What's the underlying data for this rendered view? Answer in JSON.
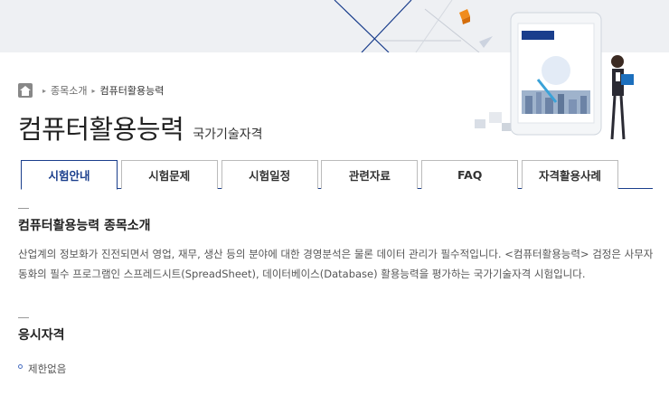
{
  "breadcrumb": {
    "items": [
      "종목소개",
      "컴퓨터활용능력"
    ]
  },
  "title": {
    "main": "컴퓨터활용능력",
    "sub": "국가기술자격"
  },
  "tabs": [
    {
      "label": "시험안내",
      "active": true
    },
    {
      "label": "시험문제",
      "active": false
    },
    {
      "label": "시험일정",
      "active": false
    },
    {
      "label": "관련자료",
      "active": false
    },
    {
      "label": "FAQ",
      "active": false
    },
    {
      "label": "자격활용사례",
      "active": false
    }
  ],
  "intro": {
    "heading": "컴퓨터활용능력 종목소개",
    "body": "산업계의 정보화가 진전되면서 영업, 재무, 생산 등의 분야에 대한 경영분석은 물론 데이터 관리가 필수적입니다. <컴퓨터활용능력> 검정은 사무자동화의 필수 프로그램인 스프레드시트(SpreadSheet), 데이터베이스(Database) 활용능력을 평가하는 국가기술자격 시험입니다."
  },
  "eligibility": {
    "heading": "응시자격",
    "item": "제한없음"
  },
  "colors": {
    "accent": "#1a3e8c",
    "band": "#eef0f3",
    "bullet": "#4a6fc2"
  },
  "icons": [
    "home-icon",
    "tablet-illustration",
    "person-illustration",
    "orange-cube-icon"
  ]
}
